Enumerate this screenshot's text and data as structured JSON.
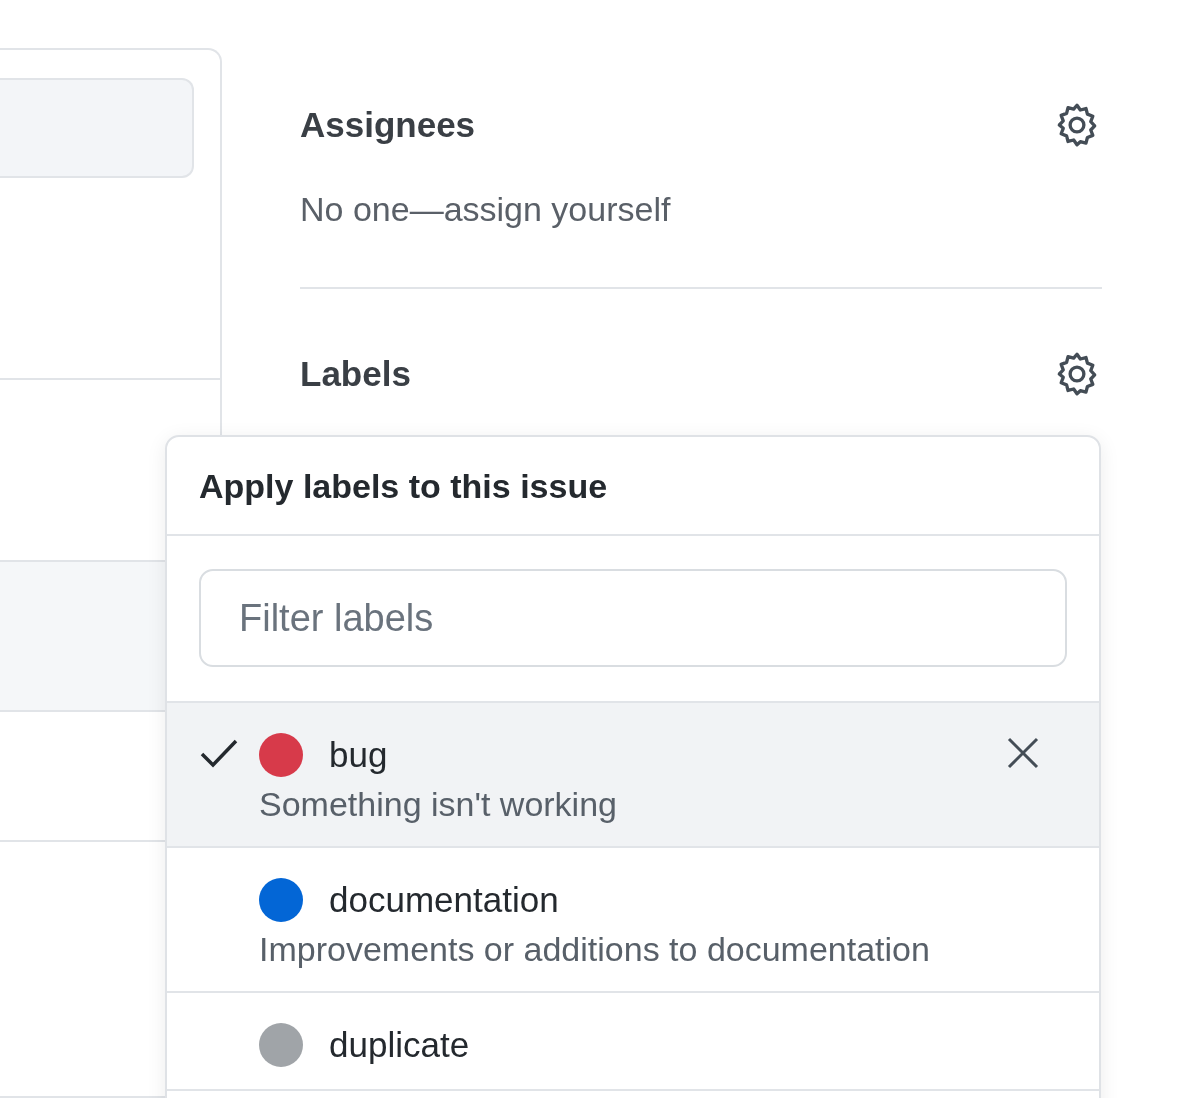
{
  "sidebar": {
    "assignees": {
      "title": "Assignees",
      "value": "No one—assign yourself"
    },
    "labels": {
      "title": "Labels"
    }
  },
  "label_menu": {
    "title": "Apply labels to this issue",
    "filter": {
      "placeholder": "Filter labels"
    },
    "items": [
      {
        "name": "bug",
        "description": "Something isn't working",
        "color": "#d73a4a",
        "selected": true
      },
      {
        "name": "documentation",
        "description": "Improvements or additions to documentation",
        "color": "#0366d6",
        "selected": false
      },
      {
        "name": "duplicate",
        "color": "#a0a4a8",
        "selected": false
      }
    ]
  }
}
